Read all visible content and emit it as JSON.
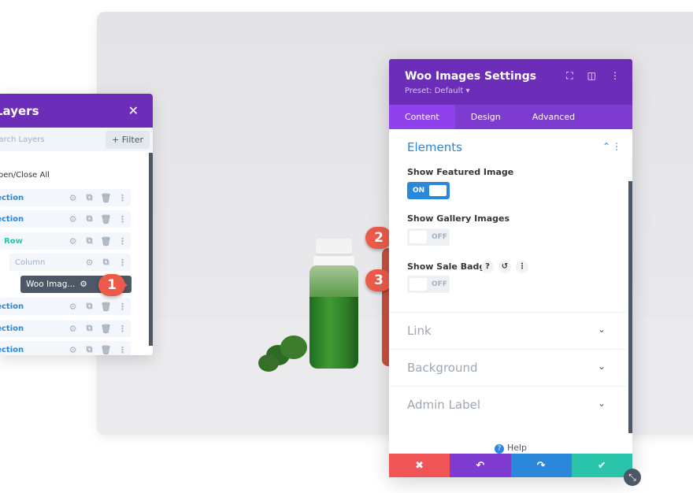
{
  "layers": {
    "title": "Layers",
    "close": "✕",
    "search_placeholder": "Search Layers",
    "filter": "+ Filter",
    "open_close_all": "Open/Close All",
    "rows": [
      {
        "label": "Section"
      },
      {
        "label": "Section"
      },
      {
        "label": "Row"
      },
      {
        "label": "Column"
      },
      {
        "label": "Woo Imag..."
      },
      {
        "label": "Section"
      },
      {
        "label": "Section"
      },
      {
        "label": "Section"
      }
    ]
  },
  "annotations": [
    "1",
    "2",
    "3"
  ],
  "panel": {
    "title": "Woo Images Settings",
    "preset": "Preset: Default ▾",
    "tabs": [
      "Content",
      "Design",
      "Advanced"
    ],
    "section_open": "Elements",
    "fields": [
      {
        "label": "Show Featured Image",
        "state": "ON"
      },
      {
        "label": "Show Gallery Images",
        "state": "OFF"
      },
      {
        "label": "Show Sale Badge",
        "state": "OFF"
      }
    ],
    "collapsed": [
      "Link",
      "Background",
      "Admin Label"
    ],
    "help": "Help"
  },
  "colors": {
    "purple": "#6c2eb9",
    "tab_active": "#8f42ec",
    "blue": "#2b87da",
    "cancel": "#ef5555",
    "undo": "#7e3bd0",
    "redo": "#2b87da",
    "save": "#29c4a9",
    "badge": "#ed5a4a"
  }
}
